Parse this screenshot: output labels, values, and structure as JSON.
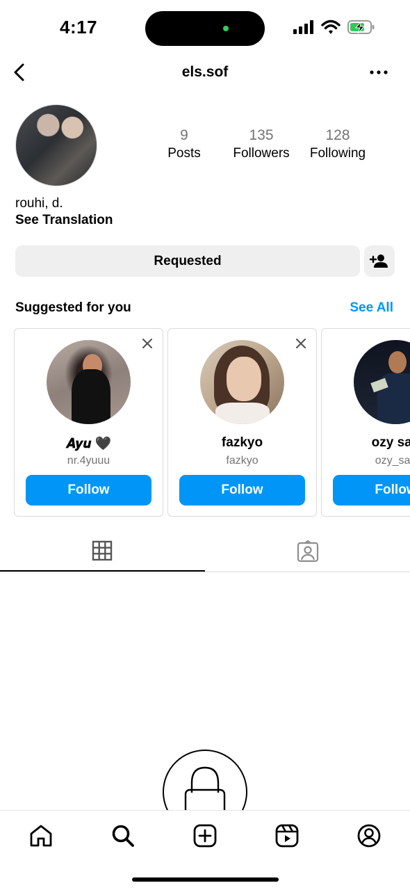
{
  "status_bar": {
    "time": "4:17"
  },
  "header": {
    "title": "els.sof"
  },
  "profile": {
    "stats": [
      {
        "value": "9",
        "label": "Posts"
      },
      {
        "value": "135",
        "label": "Followers"
      },
      {
        "value": "128",
        "label": "Following"
      }
    ],
    "bio_name": "rouhi, d.",
    "see_translation": "See Translation",
    "requested_label": "Requested"
  },
  "suggested": {
    "title": "Suggested for you",
    "see_all": "See All",
    "cards": [
      {
        "name": "𝑨𝒚𝒖 🖤",
        "handle": "nr.4yuuu",
        "button": "Follow"
      },
      {
        "name": "fazkyo",
        "handle": "fazkyo",
        "button": "Follow"
      },
      {
        "name": "ozy san",
        "handle": "ozy_san",
        "button": "Follow"
      }
    ]
  },
  "colors": {
    "accent": "#0095f6",
    "muted_text": "#737373",
    "button_bg": "#efefef"
  },
  "icons": {
    "header": [
      "back-chevron-icon",
      "more-dots-icon"
    ],
    "tabs": [
      "grid-icon",
      "tagged-person-icon"
    ],
    "nav": [
      "home-icon",
      "search-icon",
      "create-plus-icon",
      "reels-icon",
      "profile-icon"
    ]
  }
}
